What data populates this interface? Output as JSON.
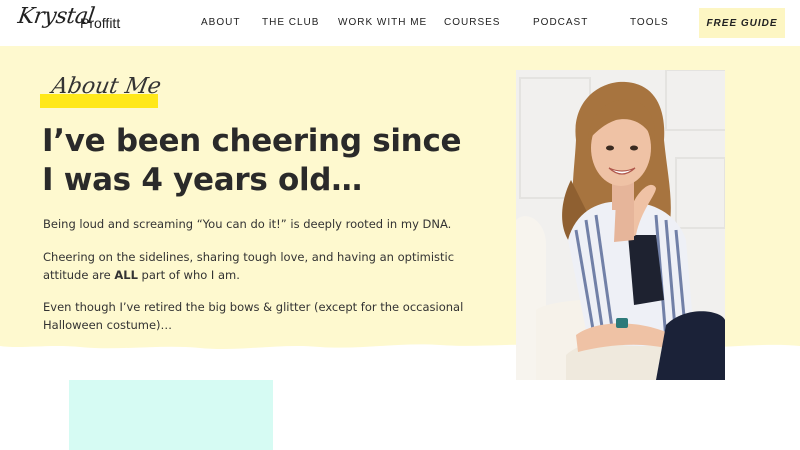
{
  "header": {
    "logo_script": "Krystal",
    "logo_sans": "Proffitt",
    "nav": [
      "ABOUT",
      "THE CLUB",
      "WORK WITH ME",
      "COURSES",
      "PODCAST",
      "TOOLS"
    ],
    "cta_label": "FREE GUIDE"
  },
  "hero": {
    "eyebrow": "About Me",
    "headline": "I’ve been cheering since I was 4 years old…",
    "p1": "Being loud and screaming “You can do it!” is deeply rooted in my DNA.",
    "p2_before": "Cheering on the sidelines, sharing tough love, and having an optimistic attitude are ",
    "p2_bold": "ALL",
    "p2_after": " part of who I am.",
    "p3": "Even though I’ve retired the big bows & glitter (except for the occasional Halloween costume)…"
  },
  "colors": {
    "hero_bg": "#fef9cf",
    "highlight": "#ffe81a",
    "cta_bg": "#fdf6c3",
    "teal": "#d6fbf3"
  },
  "icons": [
    "logo-wordmark",
    "portrait-photo"
  ]
}
